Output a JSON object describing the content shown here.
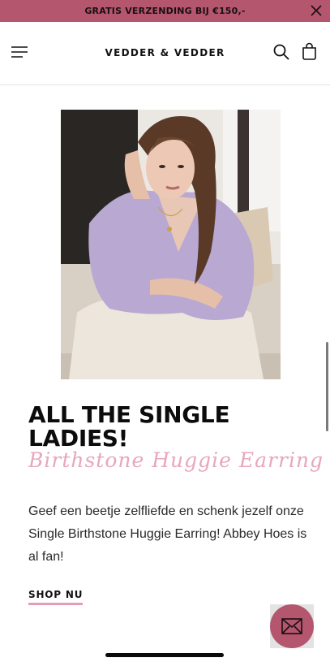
{
  "promo": {
    "text": "GRATIS VERZENDING BIJ €150,-",
    "close_icon": "close-icon"
  },
  "header": {
    "brand": "VEDDER & VEDDER",
    "menu_icon": "hamburger-menu-icon",
    "search_icon": "search-icon",
    "cart_icon": "shopping-bag-icon"
  },
  "hero": {
    "image": "photo of woman in lilac knit sweater wearing earrings"
  },
  "content": {
    "headline": "ALL THE SINGLE LADIES!",
    "script_subtitle": "Birthstone Huggie Earring",
    "body": "Geef een beetje zelfliefde en schenk jezelf onze Single Birthstone Huggie Earring! Abbey Hoes is al fan!",
    "cta": "SHOP NU"
  },
  "contact": {
    "icon": "envelope-icon"
  },
  "colors": {
    "accent": "#b5566f",
    "script_pink": "#e7a7bb",
    "cta_underline": "#e99ab6"
  }
}
